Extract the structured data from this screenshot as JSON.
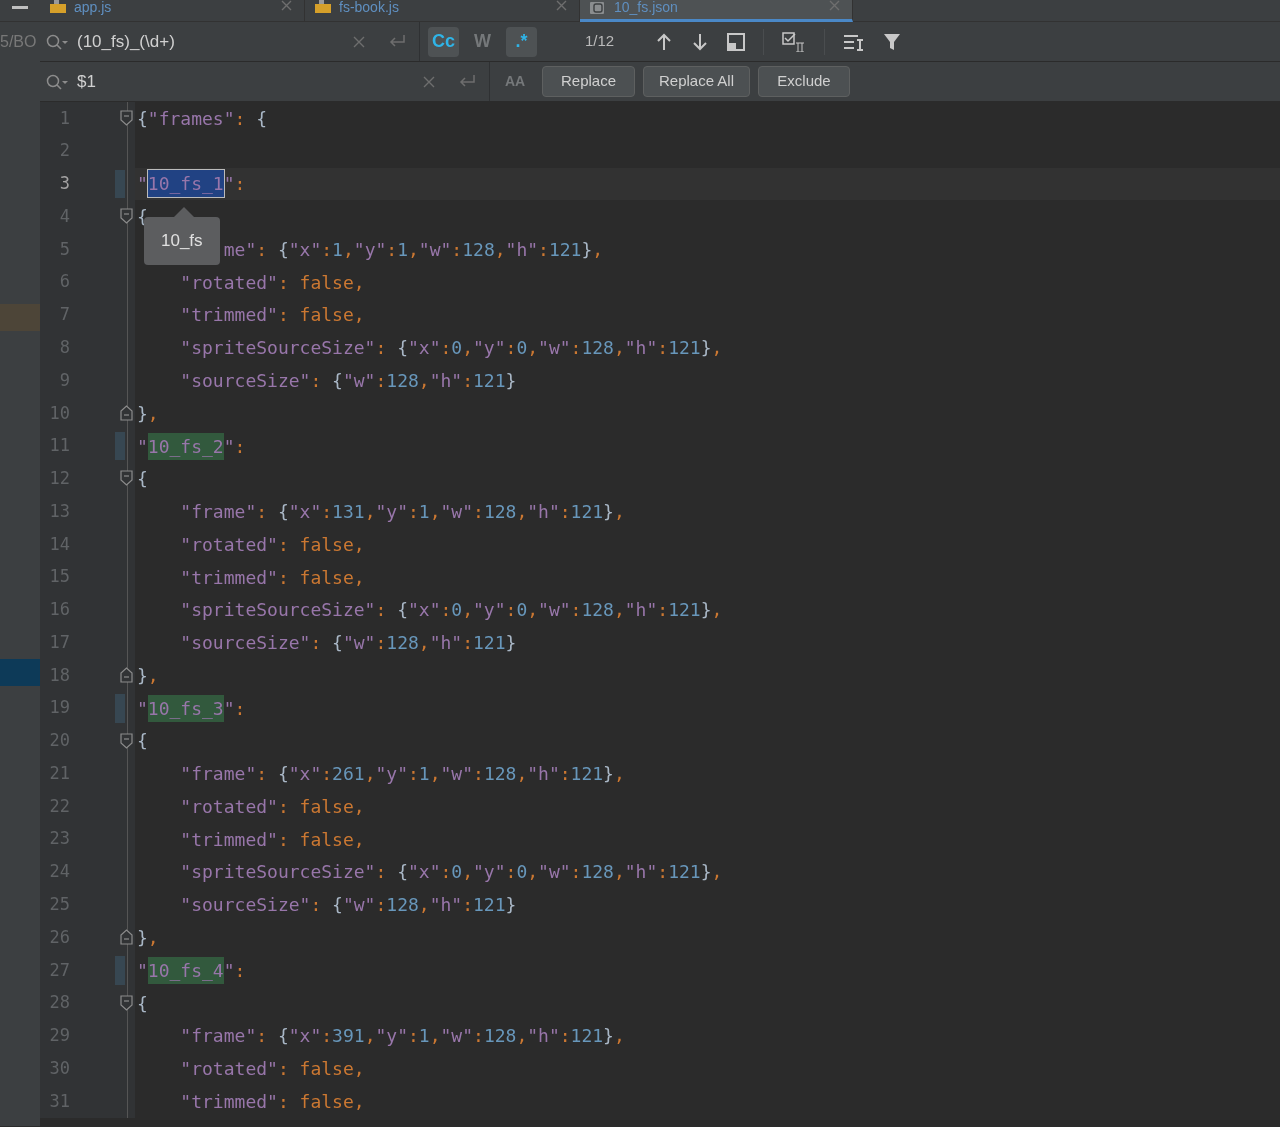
{
  "tabs": [
    {
      "label": "app.js",
      "kind": "js",
      "selected": false
    },
    {
      "label": "fs-book.js",
      "kind": "js",
      "selected": false
    },
    {
      "label": "10_fs.json",
      "kind": "json",
      "selected": true
    }
  ],
  "project_panel": {
    "text": "5/BO"
  },
  "find": {
    "value": "(10_fs)_(\\d+)",
    "options": [
      {
        "label": "Cc",
        "selected": true
      },
      {
        "label": "W",
        "selected": false
      },
      {
        "label": ".*",
        "selected": true
      }
    ],
    "count": "1/12"
  },
  "replace": {
    "value": "$1",
    "options": [
      {
        "label": "AA",
        "selected": false
      }
    ],
    "buttons": [
      "Replace",
      "Replace All",
      "Exclude"
    ]
  },
  "tooltip": "10_fs",
  "lines": [
    {
      "no": "1",
      "kind": "fold-start",
      "current": false,
      "marker": false,
      "parts": [
        {
          "kind": "code",
          "text": "{\"frames\": {"
        }
      ]
    },
    {
      "no": "2",
      "kind": "plain",
      "current": false,
      "marker": false
    },
    {
      "no": "3",
      "kind": "plain",
      "current": true,
      "marker": true,
      "parts": [
        {
          "kind": "key",
          "text": "\""
        },
        {
          "kind": "match",
          "text": "10_fs_1",
          "selected": true
        },
        {
          "kind": "key",
          "text": "\""
        },
        {
          "kind": "code",
          "text": ":"
        }
      ]
    },
    {
      "no": "4",
      "kind": "fold-start",
      "current": false,
      "marker": false,
      "parts": [
        {
          "kind": "code",
          "text": "{"
        }
      ]
    },
    {
      "no": "5",
      "kind": "plain",
      "current": false,
      "marker": false,
      "parts": [
        {
          "kind": "key",
          "text": "        me\""
        },
        {
          "kind": "code",
          "text": ": {\"x\":1,\"y\":1,\"w\":128,\"h\":121},"
        }
      ]
    },
    {
      "no": "6",
      "kind": "plain",
      "current": false,
      "marker": false,
      "parts": [
        {
          "kind": "code",
          "text": "    \"rotated\": false,"
        }
      ]
    },
    {
      "no": "7",
      "kind": "plain",
      "current": false,
      "marker": false,
      "parts": [
        {
          "kind": "code",
          "text": "    \"trimmed\": false,"
        }
      ]
    },
    {
      "no": "8",
      "kind": "plain",
      "current": false,
      "marker": false,
      "parts": [
        {
          "kind": "code",
          "text": "    \"spriteSourceSize\": {\"x\":0,\"y\":0,\"w\":128,\"h\":121},"
        }
      ]
    },
    {
      "no": "9",
      "kind": "plain",
      "current": false,
      "marker": false,
      "parts": [
        {
          "kind": "code",
          "text": "    \"sourceSize\": {\"w\":128,\"h\":121}"
        }
      ]
    },
    {
      "no": "10",
      "kind": "fold-end",
      "current": false,
      "marker": false,
      "parts": [
        {
          "kind": "code",
          "text": "},"
        }
      ]
    },
    {
      "no": "11",
      "kind": "plain",
      "current": false,
      "marker": true,
      "parts": [
        {
          "kind": "key",
          "text": "\""
        },
        {
          "kind": "match",
          "text": "10_fs_2",
          "selected": false
        },
        {
          "kind": "key",
          "text": "\""
        },
        {
          "kind": "code",
          "text": ":"
        }
      ]
    },
    {
      "no": "12",
      "kind": "fold-start",
      "current": false,
      "marker": false,
      "parts": [
        {
          "kind": "code",
          "text": "{"
        }
      ]
    },
    {
      "no": "13",
      "kind": "plain",
      "current": false,
      "marker": false,
      "parts": [
        {
          "kind": "code",
          "text": "    \"frame\": {\"x\":131,\"y\":1,\"w\":128,\"h\":121},"
        }
      ]
    },
    {
      "no": "14",
      "kind": "plain",
      "current": false,
      "marker": false,
      "parts": [
        {
          "kind": "code",
          "text": "    \"rotated\": false,"
        }
      ]
    },
    {
      "no": "15",
      "kind": "plain",
      "current": false,
      "marker": false,
      "parts": [
        {
          "kind": "code",
          "text": "    \"trimmed\": false,"
        }
      ]
    },
    {
      "no": "16",
      "kind": "plain",
      "current": false,
      "marker": false,
      "parts": [
        {
          "kind": "code",
          "text": "    \"spriteSourceSize\": {\"x\":0,\"y\":0,\"w\":128,\"h\":121},"
        }
      ]
    },
    {
      "no": "17",
      "kind": "plain",
      "current": false,
      "marker": false,
      "parts": [
        {
          "kind": "code",
          "text": "    \"sourceSize\": {\"w\":128,\"h\":121}"
        }
      ]
    },
    {
      "no": "18",
      "kind": "fold-end",
      "current": false,
      "marker": false,
      "parts": [
        {
          "kind": "code",
          "text": "},"
        }
      ]
    },
    {
      "no": "19",
      "kind": "plain",
      "current": false,
      "marker": true,
      "parts": [
        {
          "kind": "key",
          "text": "\""
        },
        {
          "kind": "match",
          "text": "10_fs_3",
          "selected": false
        },
        {
          "kind": "key",
          "text": "\""
        },
        {
          "kind": "code",
          "text": ":"
        }
      ]
    },
    {
      "no": "20",
      "kind": "fold-start",
      "current": false,
      "marker": false,
      "parts": [
        {
          "kind": "code",
          "text": "{"
        }
      ]
    },
    {
      "no": "21",
      "kind": "plain",
      "current": false,
      "marker": false,
      "parts": [
        {
          "kind": "code",
          "text": "    \"frame\": {\"x\":261,\"y\":1,\"w\":128,\"h\":121},"
        }
      ]
    },
    {
      "no": "22",
      "kind": "plain",
      "current": false,
      "marker": false,
      "parts": [
        {
          "kind": "code",
          "text": "    \"rotated\": false,"
        }
      ]
    },
    {
      "no": "23",
      "kind": "plain",
      "current": false,
      "marker": false,
      "parts": [
        {
          "kind": "code",
          "text": "    \"trimmed\": false,"
        }
      ]
    },
    {
      "no": "24",
      "kind": "plain",
      "current": false,
      "marker": false,
      "parts": [
        {
          "kind": "code",
          "text": "    \"spriteSourceSize\": {\"x\":0,\"y\":0,\"w\":128,\"h\":121},"
        }
      ]
    },
    {
      "no": "25",
      "kind": "plain",
      "current": false,
      "marker": false,
      "parts": [
        {
          "kind": "code",
          "text": "    \"sourceSize\": {\"w\":128,\"h\":121}"
        }
      ]
    },
    {
      "no": "26",
      "kind": "fold-end",
      "current": false,
      "marker": false,
      "parts": [
        {
          "kind": "code",
          "text": "},"
        }
      ]
    },
    {
      "no": "27",
      "kind": "plain",
      "current": false,
      "marker": true,
      "parts": [
        {
          "kind": "key",
          "text": "\""
        },
        {
          "kind": "match",
          "text": "10_fs_4",
          "selected": false
        },
        {
          "kind": "key",
          "text": "\""
        },
        {
          "kind": "code",
          "text": ":"
        }
      ]
    },
    {
      "no": "28",
      "kind": "fold-start",
      "current": false,
      "marker": false,
      "parts": [
        {
          "kind": "code",
          "text": "{"
        }
      ]
    },
    {
      "no": "29",
      "kind": "plain",
      "current": false,
      "marker": false,
      "parts": [
        {
          "kind": "code",
          "text": "    \"frame\": {\"x\":391,\"y\":1,\"w\":128,\"h\":121},"
        }
      ]
    },
    {
      "no": "30",
      "kind": "plain",
      "current": false,
      "marker": false,
      "parts": [
        {
          "kind": "code",
          "text": "    \"rotated\": false,"
        }
      ]
    },
    {
      "no": "31",
      "kind": "plain",
      "current": false,
      "marker": false,
      "parts": [
        {
          "kind": "code",
          "text": "    \"trimmed\": false,"
        }
      ]
    }
  ]
}
